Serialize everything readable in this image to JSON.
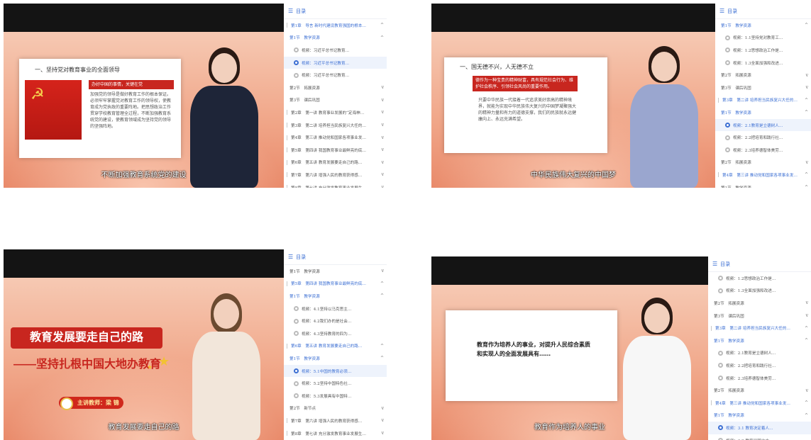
{
  "toc_title": "目录",
  "panels": [
    {
      "subtitle": "不断加强教育系统党的建设",
      "slide": {
        "heading": "一、坚持党对教育事业的全面领导",
        "band": "办好中国的事情，关键在党",
        "body": "加强党的领导是做好教育工作的根本保证。必须牢牢掌握党对教育工作的领导权，使教育成为党执政的重要阵地。把思想政治工作贯穿学校教育管理全过程，不断加强教育系统党的建设，使教育领域成为坚持党的领导的坚强阵地。"
      },
      "toc": [
        {
          "kind": "chapter",
          "text": "第1章　导言 新时代建设教育强国的根本…",
          "chev": "^",
          "blue": true
        },
        {
          "kind": "section",
          "text": "第1节　教学资源",
          "chev": "^",
          "blue": true
        },
        {
          "kind": "item",
          "text": "视频：习近平总书记教育…",
          "chev": ""
        },
        {
          "kind": "item",
          "text": "视频：习近平总书记教育…",
          "chev": "",
          "active": true
        },
        {
          "kind": "item",
          "text": "视频：习近平总书记教育…",
          "chev": ""
        },
        {
          "kind": "section",
          "text": "第2节　拓展资源",
          "chev": "v"
        },
        {
          "kind": "section",
          "text": "第3节　课后巩固",
          "chev": "v"
        },
        {
          "kind": "chapter",
          "text": "第2章　第一讲 教育事业发展的“定海神…",
          "chev": "v"
        },
        {
          "kind": "chapter",
          "text": "第3章　第二讲 培养担当民族复兴大任的…",
          "chev": "v"
        },
        {
          "kind": "chapter",
          "text": "第4章　第三讲 推动党和国家各项事业发…",
          "chev": "v"
        },
        {
          "kind": "chapter",
          "text": "第5章　第四讲 我国教育事业最鲜亮的底…",
          "chev": "v"
        },
        {
          "kind": "chapter",
          "text": "第6章　第五讲 教育发展要走自己的路…",
          "chev": "v"
        },
        {
          "kind": "chapter",
          "text": "第7章　第六讲 增强人民的教育获得感…",
          "chev": "v"
        },
        {
          "kind": "chapter",
          "text": "第8章　第七讲 充分激发教育事业发展生…",
          "chev": "v"
        }
      ]
    },
    {
      "subtitle": "中华民族伟大复兴的中国梦",
      "slide": {
        "heading": "一、国无德不兴，人无德不立",
        "band": "德作为一种宝贵的精神财富，具有规范社会行为、维护社会秩序、引领社会风尚的重要作用。",
        "body": "只要中华民族一代接着一代追求美好崇高的精神境界，就能为实现中华民族伟大复兴的中国梦凝聚强大的精神力量和有力的道德支撑，我们的民族就永远健康向上、永远充满希望。"
      },
      "toc": [
        {
          "kind": "section",
          "text": "第1节　教学资源",
          "chev": "^",
          "blue": true
        },
        {
          "kind": "item",
          "text": "视频：1.1坚持党对教育工…",
          "chev": ""
        },
        {
          "kind": "item",
          "text": "视频：1.2思想政治工作是…",
          "chev": ""
        },
        {
          "kind": "item",
          "text": "视频：1.3全面加强和改进…",
          "chev": ""
        },
        {
          "kind": "section",
          "text": "第2节　拓展资源",
          "chev": "v"
        },
        {
          "kind": "section",
          "text": "第3节　课后巩固",
          "chev": "v"
        },
        {
          "kind": "chapter",
          "text": "第3章　第二讲 培养担当民族复兴大任的…",
          "chev": "^",
          "blue": true
        },
        {
          "kind": "section",
          "text": "第1节　教学资源",
          "chev": "^",
          "blue": true
        },
        {
          "kind": "item",
          "text": "视频：2.1教育是立德树人…",
          "chev": "",
          "active": true
        },
        {
          "kind": "item",
          "text": "视频：2.2把培育和践行社…",
          "chev": ""
        },
        {
          "kind": "item",
          "text": "视频：2.3培养德智体美劳…",
          "chev": ""
        },
        {
          "kind": "section",
          "text": "第2节　拓展资源",
          "chev": "v"
        },
        {
          "kind": "chapter",
          "text": "第4章　第三讲 推动党和国家各项事业发…",
          "chev": "^",
          "blue": true
        },
        {
          "kind": "section",
          "text": "第1节　教学资源",
          "chev": "^"
        }
      ]
    },
    {
      "subtitle": "教育发展要走自己的路",
      "title1": "教育发展要走自己的路",
      "title2": "——坚持扎根中国大地办教育",
      "teacher": "主讲教师：梁 锦",
      "toc": [
        {
          "kind": "section",
          "text": "第1节　教学资源",
          "chev": "v"
        },
        {
          "kind": "chapter",
          "text": "第5章　第四讲 我国教育事业最鲜亮的底…",
          "chev": "^",
          "blue": true
        },
        {
          "kind": "section",
          "text": "第1节　教学资源",
          "chev": "^",
          "blue": true
        },
        {
          "kind": "item",
          "text": "视频：4.1坚持以马克思主…",
          "chev": ""
        },
        {
          "kind": "item",
          "text": "视频：4.2我们办的是社会…",
          "chev": ""
        },
        {
          "kind": "item",
          "text": "视频：4.3坚持教育的四为…",
          "chev": ""
        },
        {
          "kind": "chapter",
          "text": "第6章　第五讲 教育发展要走自己的路…",
          "chev": "^",
          "blue": true
        },
        {
          "kind": "section",
          "text": "第1节　教学资源",
          "chev": "^",
          "blue": true
        },
        {
          "kind": "item",
          "text": "视频：5.1中国的教育必须…",
          "chev": "",
          "active": true
        },
        {
          "kind": "item",
          "text": "视频：5.2坚持中国特色社…",
          "chev": ""
        },
        {
          "kind": "item",
          "text": "视频：5.3发展具有中国特…",
          "chev": ""
        },
        {
          "kind": "section",
          "text": "第2节　新节点",
          "chev": "v"
        },
        {
          "kind": "chapter",
          "text": "第7章　第六讲 增强人民的教育获得感…",
          "chev": "v"
        },
        {
          "kind": "chapter",
          "text": "第8章　第七讲 充分激发教育事业发展生…",
          "chev": "v"
        }
      ]
    },
    {
      "subtitle": "教育作为培养人的事业",
      "slide": {
        "body": "教育作为培养人的事业，对提升人民综合素质和实现人的全面发展具有……"
      },
      "toc": [
        {
          "kind": "item",
          "text": "视频：1.2思想政治工作是…",
          "chev": ""
        },
        {
          "kind": "item",
          "text": "视频：1.3全面加强和改进…",
          "chev": ""
        },
        {
          "kind": "section",
          "text": "第2节　拓展资源",
          "chev": "v"
        },
        {
          "kind": "section",
          "text": "第3节　课后巩固",
          "chev": "v"
        },
        {
          "kind": "chapter",
          "text": "第3章　第二讲 培养担当民族复兴大任的…",
          "chev": "^",
          "blue": true
        },
        {
          "kind": "section",
          "text": "第1节　教学资源",
          "chev": "^",
          "blue": true
        },
        {
          "kind": "item",
          "text": "视频：2.1教育是立德树人…",
          "chev": ""
        },
        {
          "kind": "item",
          "text": "视频：2.2把培育和践行社…",
          "chev": ""
        },
        {
          "kind": "item",
          "text": "视频：2.3培养德智体美劳…",
          "chev": ""
        },
        {
          "kind": "section",
          "text": "第2节　拓展资源",
          "chev": "v"
        },
        {
          "kind": "chapter",
          "text": "第4章　第三讲 推动党和国家各项事业发…",
          "chev": "^",
          "blue": true
        },
        {
          "kind": "section",
          "text": "第1节　教学资源",
          "chev": "^",
          "blue": true
        },
        {
          "kind": "item",
          "text": "视频：3.1 教育决定着人…",
          "chev": "",
          "active": true
        },
        {
          "kind": "item",
          "text": "视频：3.2 教育是国之大…",
          "chev": ""
        }
      ]
    }
  ],
  "colors": {
    "accent": "#3c6fd3",
    "party_red": "#c8261f"
  }
}
